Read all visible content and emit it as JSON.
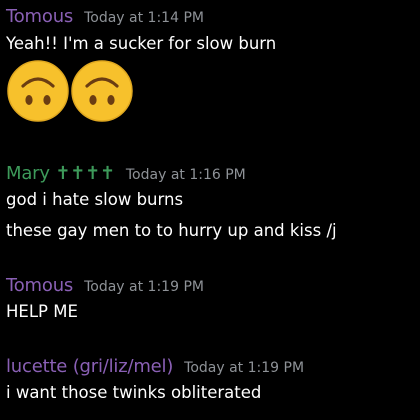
{
  "colors": {
    "background": "#000000",
    "tomous": "#8a60b5",
    "mary": "#3d9a5a",
    "lucette": "#8a60b5",
    "timestamp": "#8e9297"
  },
  "messages": [
    {
      "username": "Tomous",
      "timestamp": "Today at 1:14 PM",
      "lines": [
        "Yeah!! I'm a sucker for slow burn"
      ],
      "emojis": [
        "upside-down-face",
        "upside-down-face"
      ]
    },
    {
      "username": "Mary ✝✝✝✝",
      "timestamp": "Today at 1:16 PM",
      "lines": [
        "god i hate slow burns",
        "these gay men to to hurry up and kiss /j"
      ]
    },
    {
      "username": "Tomous",
      "timestamp": "Today at 1:19 PM",
      "lines": [
        "HELP ME"
      ]
    },
    {
      "username": "lucette (gri/liz/mel)",
      "timestamp": "Today at 1:19 PM",
      "lines": [
        "i want those twinks obliterated"
      ]
    }
  ]
}
